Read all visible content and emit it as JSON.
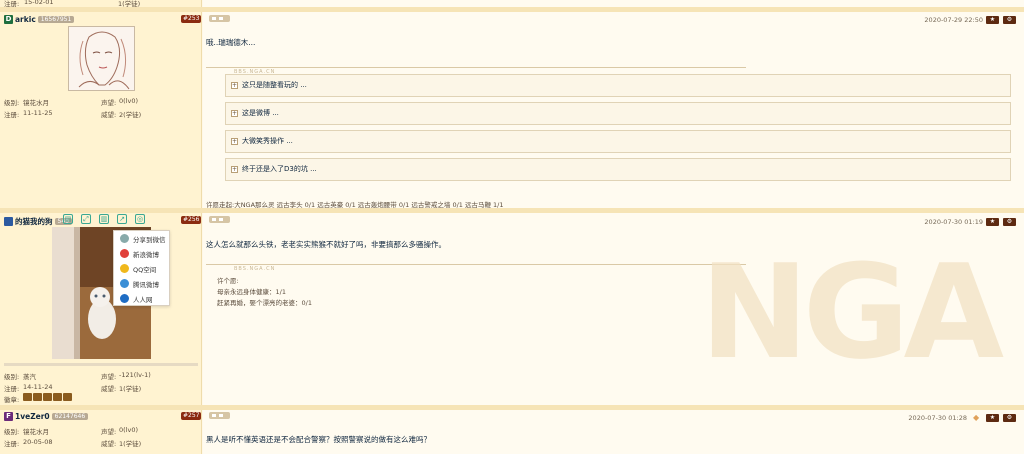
{
  "top_partial": {
    "reg_label": "注册:",
    "reg_value": "15-02-01",
    "prestige_value": "1(学徒)"
  },
  "posts": [
    {
      "username": "arkic",
      "initial": "D",
      "initial_color": "#1f6e3e",
      "uid": "16567951",
      "floor": "#253",
      "date": "2020-07-29 22:50",
      "level_label": "级别:",
      "level": "镜花水月",
      "rep_label": "声望:",
      "rep": "0(lv0)",
      "reg_label": "注册:",
      "reg": "11-11-25",
      "prestige_label": "威望:",
      "prestige": "2(学徒)",
      "content": "哦..瑞瑞德木...",
      "watermark": "BBS.NGA.CN",
      "collapses": [
        "这只是随整看玩的 ...",
        "这是微博 ...",
        "大微笑秀操作 ...",
        "终于还是入了D3的坑 ..."
      ],
      "wishes": "许愿走起:大NGA那么灵 远古李头 0/1 远古英豪 0/1 远古轰炮腰带 0/1 远古警戒之墙 0/1 远古马鞭 1/1"
    },
    {
      "username": "的猫我的狗",
      "initial": "",
      "uid": "540",
      "floor": "#256",
      "date": "2020-07-30 01:19",
      "level_label": "级别:",
      "level": "蒸汽",
      "rep_label": "声望:",
      "rep": "-121(lv-1)",
      "reg_label": "注册:",
      "reg": "14-11-24",
      "prestige_label": "威望:",
      "prestige": "1(学徒)",
      "medal_label": "徽章:",
      "content": "这人怎么就那么头铁，老老实实熊猴不就好了吗，非要搞那么多骚操作。",
      "watermark": "BBS.NGA.CN",
      "wish_lines": [
        "许个愿:",
        "母亲永远身体健康：1/1",
        "赶紧再婚，娶个漂亮的老婆：0/1"
      ]
    },
    {
      "username": "1veZer0",
      "initial": "F",
      "initial_color": "#6b2b7a",
      "uid": "62147646",
      "floor": "#257",
      "date": "2020-07-30 01:28",
      "level_label": "级别:",
      "level": "镜花水月",
      "rep_label": "声望:",
      "rep": "0(lv0)",
      "reg_label": "注册:",
      "reg": "20-05-08",
      "prestige_label": "威望:",
      "prestige": "1(学徒)",
      "content": "黑人是听不懂英语还是不会配合警察？按照警察说的做有这么难吗？"
    }
  ],
  "share_menu": [
    "分享到微信",
    "新浪微博",
    "QQ空间",
    "腾讯微博",
    "人人网"
  ],
  "icons": {
    "star": "★",
    "gear": "⚙"
  },
  "bg_watermark": "NGA"
}
